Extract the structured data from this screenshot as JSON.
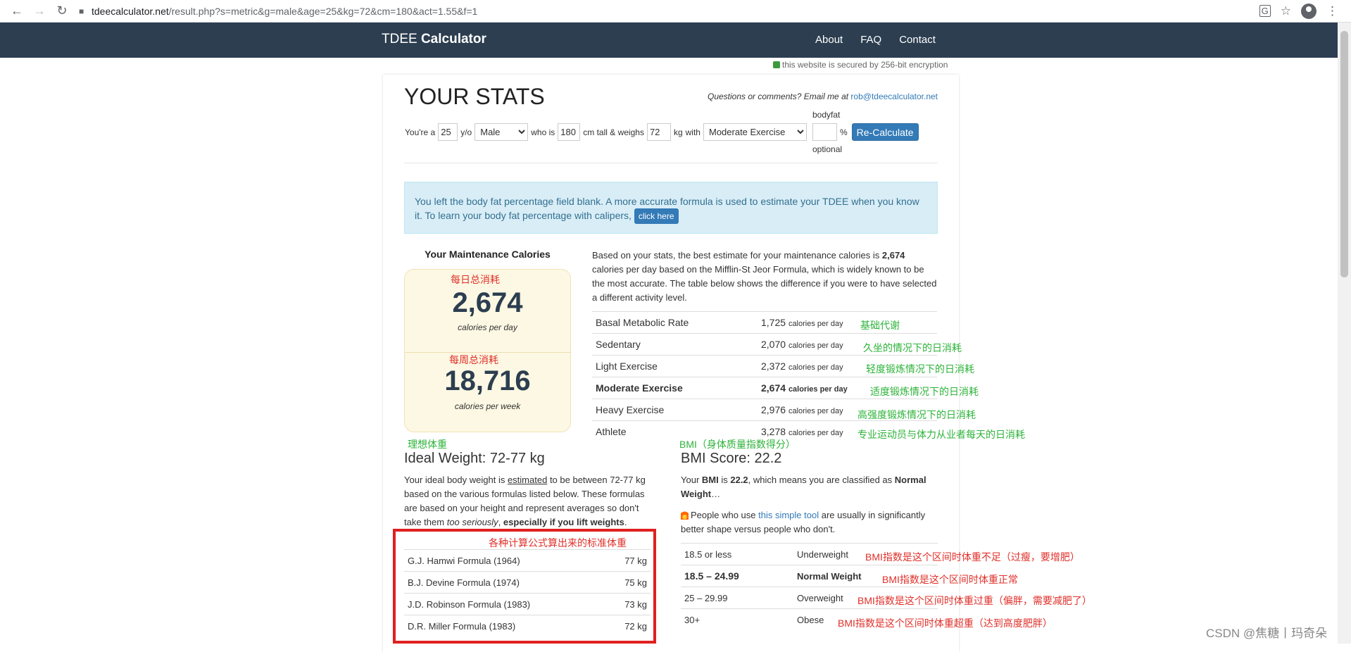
{
  "browser": {
    "url_host": "tdeecalculator.net",
    "url_path": "/result.php?s=metric&g=male&age=25&kg=72&cm=180&act=1.55&f=1"
  },
  "nav": {
    "brand_light": "TDEE ",
    "brand_bold": "Calculator",
    "links": [
      "About",
      "FAQ",
      "Contact"
    ]
  },
  "secure_text": "this website is secured by 256-bit encryption",
  "page_title": "YOUR STATS",
  "contact": {
    "text": "Questions or comments? Email me at ",
    "email": "rob@tdeecalculator.net"
  },
  "form": {
    "youre_a": "You're a",
    "age": "25",
    "yo": "y/o",
    "gender": "Male",
    "who_is": "who is",
    "height": "180",
    "cm_tall": "cm tall & weighs",
    "weight": "72",
    "kg_with": "kg",
    "with": "with",
    "activity": "Moderate Exercise",
    "bodyfat_label": "bodyfat",
    "bodyfat_value": "",
    "percent": "%",
    "optional": "optional",
    "recalc": "Re-Calculate"
  },
  "alert": {
    "text": "You left the body fat percentage field blank. A more accurate formula is used to estimate your TDEE when you know it. To learn your body fat percentage with calipers,",
    "button": "click here"
  },
  "maintenance": {
    "label": "Your Maintenance Calories",
    "daily": "2,674",
    "daily_unit": "calories per day",
    "weekly": "18,716",
    "weekly_unit": "calories per week"
  },
  "explain": {
    "pre": "Based on your stats, the best estimate for your maintenance calories is ",
    "bold": "2,674",
    "post": " calories per day based on the Mifflin-St Jeor Formula, which is widely known to be the most accurate. The table below shows the difference if you were to have selected a different activity level."
  },
  "activity_rows": [
    {
      "label": "Basal Metabolic Rate",
      "value": "1,725",
      "unit": "calories per day"
    },
    {
      "label": "Sedentary",
      "value": "2,070",
      "unit": "calories per day"
    },
    {
      "label": "Light Exercise",
      "value": "2,372",
      "unit": "calories per day"
    },
    {
      "label": "Moderate Exercise",
      "value": "2,674",
      "unit": "calories per day"
    },
    {
      "label": "Heavy Exercise",
      "value": "2,976",
      "unit": "calories per day"
    },
    {
      "label": "Athlete",
      "value": "3,278",
      "unit": "calories per day"
    }
  ],
  "annotations": {
    "daily": "每日总消耗",
    "weekly": "每周总消耗",
    "bmr": "基础代谢",
    "sedentary": "久坐的情况下的日消耗",
    "light": "轻度锻炼情况下的日消耗",
    "moderate": "适度锻炼情况下的日消耗",
    "heavy": "高强度锻炼情况下的日消耗",
    "athlete": "专业运动员与体力从业者每天的日消耗",
    "ideal": "理想体重",
    "bmi": "BMI（身体质量指数得分）",
    "formulas": "各种计算公式算出来的标准体重",
    "under": "BMI指数是这个区间时体重不足（过瘦，要增肥）",
    "normal": "BMI指数是这个区间时体重正常",
    "over": "BMI指数是这个区间时体重过重（偏胖，需要减肥了）",
    "obese": "BMI指数是这个区间时体重超重（达到高度肥胖）"
  },
  "ideal": {
    "title": "Ideal Weight: 72-77 kg",
    "p1": "Your ideal body weight is ",
    "p_est": "estimated",
    "p2": " to be between 72-77 kg based on the various formulas listed below. These formulas are based on your height and represent averages so don't take them ",
    "p_it": "too seriously",
    "p3": ", ",
    "p_bold": "especially if you lift weights",
    "p4": ".",
    "rows": [
      {
        "formula": "G.J. Hamwi Formula (1964)",
        "value": "77 kg"
      },
      {
        "formula": "B.J. Devine Formula (1974)",
        "value": "75 kg"
      },
      {
        "formula": "J.D. Robinson Formula (1983)",
        "value": "73 kg"
      },
      {
        "formula": "D.R. Miller Formula (1983)",
        "value": "72 kg"
      }
    ]
  },
  "bmi": {
    "title": "BMI Score: 22.2",
    "p1": "Your ",
    "p_bmi": "BMI",
    "p2": " is ",
    "p_val": "22.2",
    "p3": ", which means you are classified as ",
    "p_class": "Normal Weight",
    "p4": "…",
    "tip1": "People who use ",
    "tip_link": "this simple tool",
    "tip2": " are usually in significantly better shape versus people who don't.",
    "rows": [
      {
        "range": "18.5 or less",
        "class": "Underweight"
      },
      {
        "range": "18.5 – 24.99",
        "class": "Normal Weight"
      },
      {
        "range": "25 – 29.99",
        "class": "Overweight"
      },
      {
        "range": "30+",
        "class": "Obese"
      }
    ]
  },
  "watermark": "CSDN @焦糖丨玛奇朵"
}
